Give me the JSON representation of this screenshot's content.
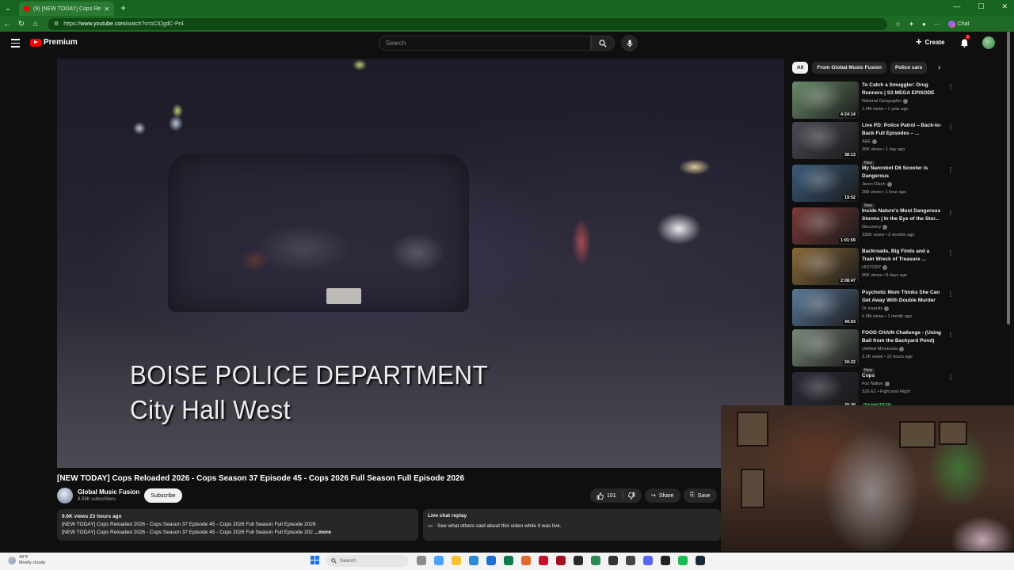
{
  "browser": {
    "tab_title": "(9) [NEW TODAY] Cops Reload",
    "url_prefix": "https://",
    "url_domain": "www.youtube.com",
    "url_path": "/watch?v=oCIDgdC-Pr4",
    "chat_label": "Chat"
  },
  "header": {
    "brand": "Premium",
    "search_placeholder": "Search",
    "create_label": "Create",
    "notif_count": "3"
  },
  "video": {
    "caption_line1": "BOISE POLICE DEPARTMENT",
    "caption_line2": "City Hall West",
    "title": "[NEW TODAY] Cops Reloaded 2026 - Cops Season 37 Episode 45 - Cops 2026 Full Season Full Episode 2026",
    "channel": "Global Music Fusion",
    "subscribers": "8.58K subscribers",
    "subscribe_label": "Subscribe",
    "likes": "151",
    "share_label": "Share",
    "save_label": "Save",
    "views_meta": "9.6K views  23 hours ago",
    "desc_line1": "[NEW TODAY] Cops Reloaded 2026 - Cops Season 37 Episode 45 - Cops 2026 Full Season Full Episode 2026",
    "desc_line2": "[NEW TODAY] Cops Reloaded 2026 - Cops Season 37 Episode 45 - Cops 2026 Full Season Full Episode 202",
    "more_label": "...more",
    "chat_replay_title": "Live chat replay",
    "chat_replay_text": "See what others said about this video while it was live."
  },
  "chips": [
    "All",
    "From Global Music Fusion",
    "Police cars"
  ],
  "recommendations": [
    {
      "title": "To Catch a Smuggler: Drug Runners | S3 MEGA EPISODE",
      "channel": "National Geographic",
      "meta": "1.4M views • 1 year ago",
      "duration": "4:24:14",
      "badge": "",
      "color": "#6a8a6a"
    },
    {
      "title": "Live PD: Police Patrol – Back-to-Back Full Episodes – ...",
      "channel": "A&E",
      "meta": "90K views • 1 day ago",
      "duration": "38:13",
      "badge": "New",
      "color": "#4a4a55"
    },
    {
      "title": "My Nanrobot D6 Scooter is Dangerous",
      "channel": "Jaron Olech",
      "meta": "288 views • 1 hour ago",
      "duration": "19:52",
      "badge": "New",
      "color": "#3a5a7a"
    },
    {
      "title": "Inside Nature's Most Dangerous Storms | In the Eye of the Stor...",
      "channel": "Discovery",
      "meta": "335K views • 3 months ago",
      "duration": "1:01:59",
      "badge": "",
      "color": "#7a3a3a"
    },
    {
      "title": "Backroads, Big Finds and a Train Wreck of Treasure ...",
      "channel": "HISTORY",
      "meta": "90K views • 8 days ago",
      "duration": "2:08:47",
      "badge": "",
      "color": "#8a6a3a"
    },
    {
      "title": "Psychotic Mom Thinks She Can Get Away With Double Murder",
      "channel": "Dr Insanity",
      "meta": "6.9M views • 1 month ago",
      "duration": "49:03",
      "badge": "",
      "color": "#5a7a9a"
    },
    {
      "title": "FOOD CHAIN Challenge - (Using Bait from the Backyard Pond)",
      "channel": "UnReel Minnesota",
      "meta": "3.2K views • 22 hours ago",
      "duration": "20:22",
      "badge": "New",
      "color": "#7a8a7a"
    },
    {
      "title": "Cops",
      "channel": "Fox Nation",
      "meta": "S26 E1 • Fight and Flight",
      "duration": "20:30",
      "badge": "Try now  TV-14",
      "color": "#2a2a3a"
    }
  ],
  "taskbar": {
    "temp": "49°F",
    "weather": "Mostly cloudy",
    "search_label": "Search"
  }
}
